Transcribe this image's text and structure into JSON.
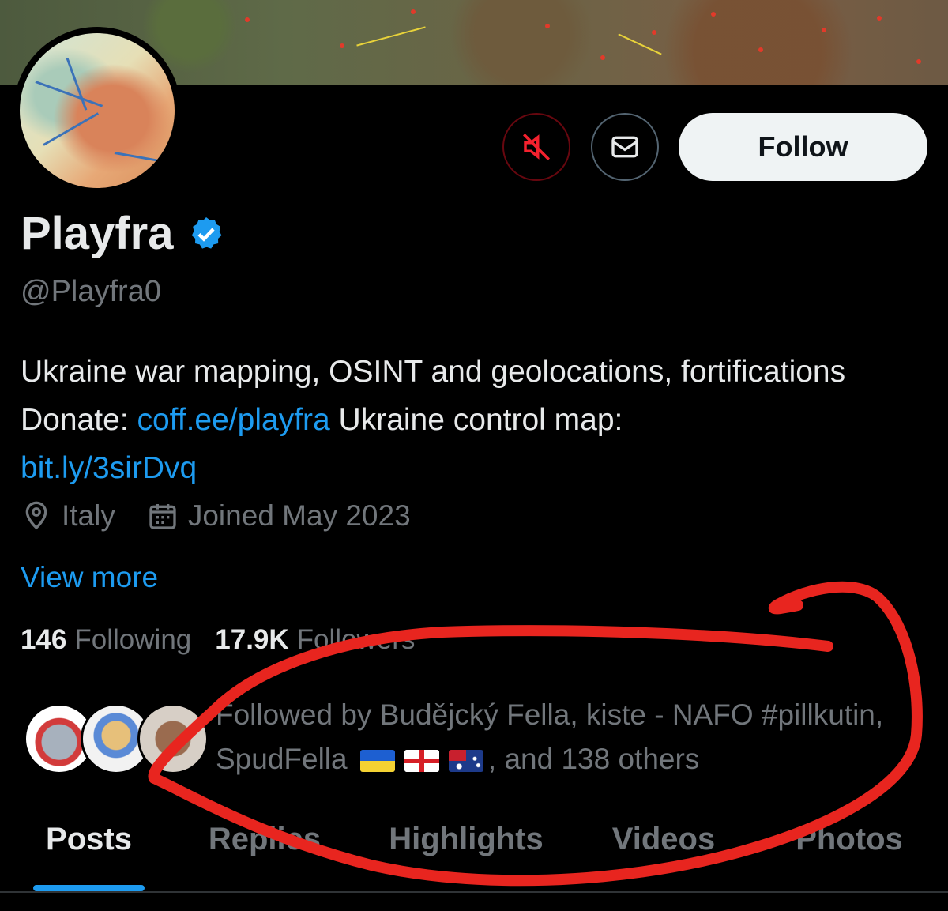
{
  "profile": {
    "name": "Playfra",
    "handle": "@Playfra0",
    "bio": {
      "text1": "Ukraine war mapping, OSINT and geolocations, fortifications Donate: ",
      "link1": "coff.ee/playfra",
      "text2": " Ukraine control map: ",
      "link2": "bit.ly/3sirDvq"
    },
    "location": "Italy",
    "joined": "Joined May 2023",
    "view_more": "View more"
  },
  "actions": {
    "mute_icon": "muted-speaker-icon",
    "message_icon": "envelope-icon",
    "follow_label": "Follow"
  },
  "stats": {
    "following_count": "146",
    "following_label": "Following",
    "followers_count": "17.9K",
    "followers_label": "Followers"
  },
  "followed_by": {
    "text": "Followed by Budějcký Fella, kiste - NAFO #pillkutin, SpudFella",
    "flags": [
      "ukraine-flag",
      "georgia-flag",
      "australia-flag"
    ],
    "suffix": ", and 138 others"
  },
  "tabs": [
    "Posts",
    "Replies",
    "Highlights",
    "Videos",
    "Photos"
  ],
  "active_tab": "Posts",
  "colors": {
    "background": "#000000",
    "accent": "#1d9bf0",
    "text_primary": "#e7e9ea",
    "text_secondary": "#71767b",
    "annotation": "#e8251f"
  }
}
